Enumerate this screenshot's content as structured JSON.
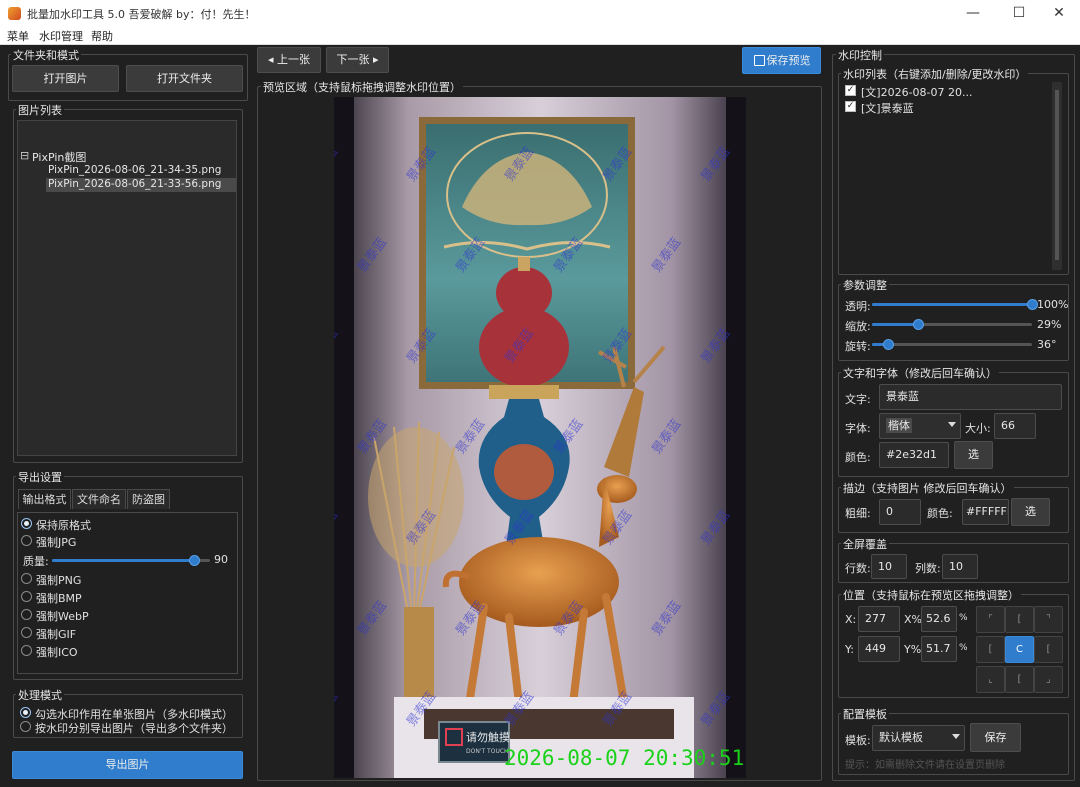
{
  "window": {
    "title": "批量加水印工具 5.0    吾爱破解 by：付！先生！",
    "min_glyph": "—",
    "max_glyph": "☐",
    "close_glyph": "✕"
  },
  "menu": [
    "菜单",
    "水印管理",
    "帮助"
  ],
  "left": {
    "files_group": "文件夹和模式",
    "open_image": "打开图片",
    "open_folder": "打开文件夹",
    "image_list_group": "图片列表",
    "tree": {
      "folder_toggle": "⊟",
      "folder": "PixPin截图",
      "files": [
        "PixPin_2026-08-06_21-34-35.png",
        "PixPin_2026-08-06_21-33-56.png"
      ],
      "selected_index": 1
    },
    "export_group": "导出设置",
    "tabs": [
      "输出格式",
      "文件命名",
      "防盗图"
    ],
    "active_tab": 0,
    "formats_top": [
      "保持原格式",
      "强制JPG"
    ],
    "quality_label": "质量:",
    "quality_value": "90",
    "quality_fraction": 0.9,
    "formats_bottom": [
      "强制PNG",
      "强制BMP",
      "强制WebP",
      "强制GIF",
      "强制ICO"
    ],
    "process_group": "处理模式",
    "process_modes": [
      "勾选水印作用在单张图片（多水印模式）",
      "按水印分别导出图片（导出多个文件夹）"
    ],
    "export_button": "导出图片"
  },
  "center": {
    "prev": "◂ 上一张",
    "next": "下一张 ▸",
    "save_preview": "保存预览",
    "preview_group": "预览区域（支持鼠标拖拽调整水印位置）",
    "watermark_text": "景泰蓝",
    "timestamp": "2026-08-07  20:30:51",
    "sign_text": "请勿触摸",
    "sign_sub": "DON'T TOUCH"
  },
  "right": {
    "control_group": "水印控制",
    "list_group": "水印列表（右键添加/删除/更改水印）",
    "watermarks": [
      "[文]2026-08-07 20...",
      "[文]景泰蓝"
    ],
    "params_group": "参数调整",
    "params": [
      {
        "label": "透明:",
        "value": "100%",
        "fraction": 1.0
      },
      {
        "label": "缩放:",
        "value": "29%",
        "fraction": 0.29
      },
      {
        "label": "旋转:",
        "value": "36°",
        "fraction": 0.1
      }
    ],
    "font_group": "文字和字体（修改后回车确认）",
    "text_label": "文字:",
    "text_value": "景泰蓝",
    "font_label": "字体:",
    "font_value": "楷体",
    "size_label": "大小:",
    "size_value": "66",
    "color_label": "颜色:",
    "color_value": "#2e32d1",
    "pick": "选",
    "stroke_group": "描边（支持图片 修改后回车确认）",
    "stroke_width_label": "粗细:",
    "stroke_width": "0",
    "stroke_color_label": "颜色:",
    "stroke_color": "#FFFFFF",
    "tile_group": "全屏覆盖",
    "rows_label": "行数:",
    "rows": "10",
    "cols_label": "列数:",
    "cols": "10",
    "position_group": "位置（支持鼠标在预览区拖拽调整）",
    "x_label": "X:",
    "x_value": "277",
    "xp_label": "X%",
    "xp_value": "52.6",
    "y_label": "Y:",
    "y_value": "449",
    "yp_label": "Y%",
    "yp_value": "51.7",
    "pct": "%",
    "grid_glyphs": [
      "⌜",
      "[",
      "⌝",
      "[",
      "C",
      "[",
      "⌞",
      "[",
      "⌟"
    ],
    "template_group": "配置模板",
    "template_label": "模板:",
    "template_value": "默认模板",
    "save": "保存",
    "hint": "提示：如需删除文件请在设置页删除"
  },
  "colors": {
    "accent": "#2f7dcc",
    "watermark": "#2e32d1",
    "timestamp": "#19d219"
  }
}
